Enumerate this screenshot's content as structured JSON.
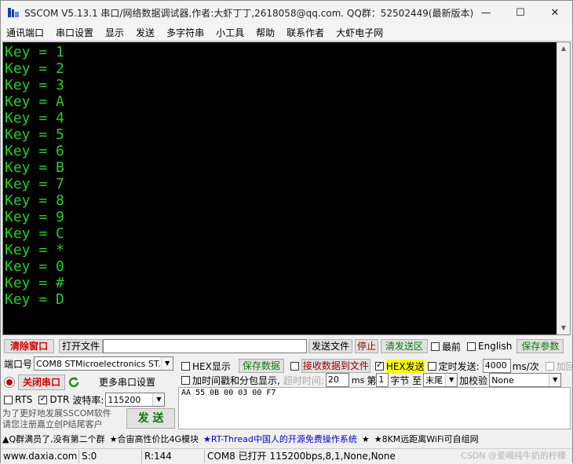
{
  "window": {
    "title": "SSCOM V5.13.1 串口/网络数据调试器,作者:大虾丁丁,2618058@qq.com. QQ群：52502449(最新版本)",
    "minimize": "—",
    "maximize": "☐",
    "close": "✕"
  },
  "menu": [
    "通讯端口",
    "串口设置",
    "显示",
    "发送",
    "多字符串",
    "小工具",
    "帮助",
    "联系作者",
    "大虾电子网"
  ],
  "terminal": {
    "lines": [
      "Key = 1",
      "Key = 2",
      "Key = 3",
      "Key = A",
      "Key = 4",
      "Key = 5",
      "Key = 6",
      "Key = B",
      "Key = 7",
      "Key = 8",
      "Key = 9",
      "Key = C",
      "Key = *",
      "Key = 0",
      "Key = #",
      "Key = D"
    ],
    "text_color": "#22d022"
  },
  "toolbar": {
    "clear_window": "清除窗口",
    "open_file": "打开文件",
    "file_path": "",
    "send_file": "发送文件",
    "stop": "停止",
    "clear_send": "清发送区",
    "topmost": "最前",
    "english": "English",
    "save_params": "保存参数"
  },
  "port": {
    "label": "端口号",
    "value": "COM8 STMicroelectronics ST...",
    "close_port": "关闭串口",
    "more_settings": "更多串口设置",
    "rts": "RTS",
    "dtr": "DTR",
    "baud_label": "波特率:",
    "baud_value": "115200",
    "promo_line1": "为了更好地发展SSCOM软件",
    "promo_line2": "请您注册嘉立创P结尾客户",
    "send_btn": "发 送"
  },
  "options": {
    "hex_display": "HEX显示",
    "save_data": "保存数据",
    "recv_to_file": "接收数据到文件",
    "hex_send": "HEX发送",
    "timed_send": "定时发送:",
    "interval": "4000",
    "interval_unit": "ms/次",
    "add_crlf": "加回车换行",
    "timestamp": "加时间戳和分包显示,",
    "timeout_label": "超时时间:",
    "timeout_value": "20",
    "timeout_unit": "ms",
    "byte_label": "第",
    "byte_value": "1",
    "byte_unit": "字节 至",
    "end_value": "末尾",
    "checksum_label": "加校验",
    "checksum_value": "None"
  },
  "send_data": "AA 55 0B 00 03 00 F7",
  "ad_bar": [
    {
      "text": "▲Q群满员了,没有第二个群",
      "color": "#000000"
    },
    {
      "text": "★合宙高性价比4G模块",
      "color": "#000000"
    },
    {
      "text": "★RT-Thread中国人的开源免费操作系统",
      "color": "#0000cc"
    },
    {
      "text": "★",
      "color": "#000000"
    },
    {
      "text": "★8KM远距离WiFi可自组网",
      "color": "#000000"
    }
  ],
  "status": {
    "website": "www.daxia.com",
    "sent": "S:0",
    "received": "R:144",
    "port_info": "COM8 已打开  115200bps,8,1,None,None"
  },
  "watermark": "CSDN @爱喝纯牛奶的柠檬"
}
